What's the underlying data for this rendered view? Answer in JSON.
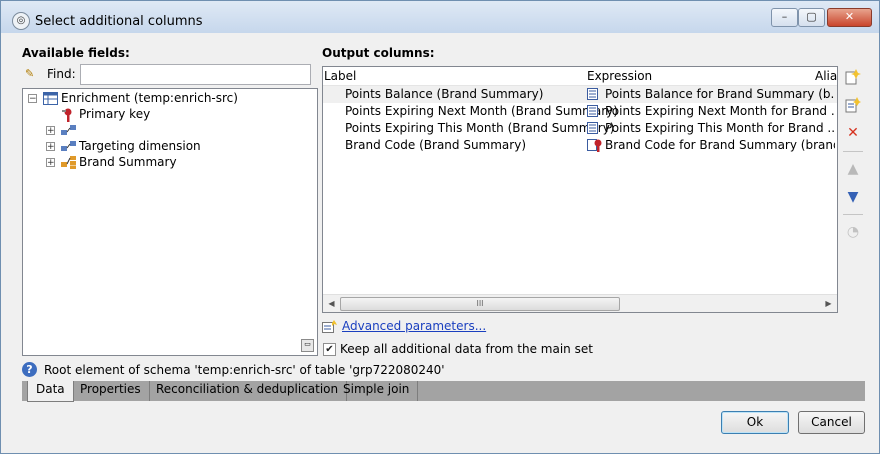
{
  "window": {
    "title": "Select additional columns",
    "controls": {
      "minimize": "–",
      "maximize": "▢",
      "close": "✕"
    }
  },
  "available_fields": {
    "heading": "Available fields:",
    "find_label": "Find:",
    "find_value": "",
    "tree": [
      {
        "label": "Enrichment (temp:enrich-src)",
        "expander": "−",
        "icon": "table-icon"
      },
      {
        "label": "Primary key",
        "icon": "primary-key-icon"
      },
      {
        "label": "",
        "expander": "+",
        "icon": "link-icon"
      },
      {
        "label": "Targeting dimension",
        "expander": "+",
        "icon": "link-icon"
      },
      {
        "label": "Brand Summary",
        "expander": "+",
        "icon": "collection-link-icon"
      }
    ]
  },
  "output_columns": {
    "heading": "Output columns:",
    "headers": {
      "label": "Label",
      "expression": "Expression",
      "alias": "Alias"
    },
    "rows": [
      {
        "label": "Points Balance (Brand Summary)",
        "expression": "Points Balance for Brand Summary (b...",
        "icon": "expression-icon"
      },
      {
        "label": "Points Expiring Next Month (Brand Summary)",
        "expression": "Points Expiring Next Month for Brand ...",
        "icon": "expression-icon"
      },
      {
        "label": "Points Expiring This Month (Brand Summary)",
        "expression": "Points Expiring This Month for Brand ...",
        "icon": "expression-icon"
      },
      {
        "label": "Brand Code (Brand Summary)",
        "expression": "Brand Code for Brand Summary (brandS",
        "icon": "key-expression-icon"
      }
    ],
    "scrollbar_grip": "III"
  },
  "advanced_parameters": "Advanced parameters...",
  "keep_data": {
    "label": "Keep all additional data from the main set",
    "checked": true
  },
  "status": "Root element of schema 'temp:enrich-src' of table 'grp722080240'",
  "tabs": [
    "Data",
    "Properties",
    "Reconciliation & deduplication",
    "Simple join"
  ],
  "active_tab": "Data",
  "buttons": {
    "ok": "Ok",
    "cancel": "Cancel"
  },
  "colors": {
    "title_bar": "#c6d7ec",
    "link": "#1a3fbf",
    "selected_row": "#f0f0f0",
    "tab_bar": "#a3a3a3"
  }
}
